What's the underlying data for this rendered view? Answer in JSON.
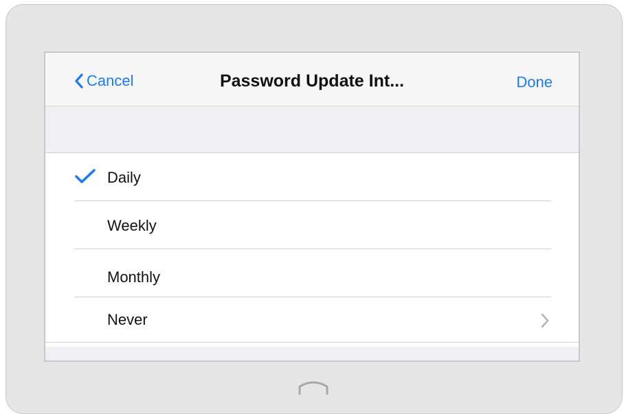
{
  "navbar": {
    "back_label": "Cancel",
    "title": "Password Update Int...",
    "done_label": "Done"
  },
  "options": [
    {
      "label": "Daily",
      "selected": true
    },
    {
      "label": "Weekly",
      "selected": false
    },
    {
      "label": "Monthly",
      "selected": false
    },
    {
      "label": "Never",
      "selected": false,
      "has_disclosure": true
    }
  ],
  "colors": {
    "accent": "#1a7cf0",
    "group_background": "#efeff4",
    "device_bezel": "#e6e6e6"
  },
  "icons": {
    "back": "chevron-left-icon",
    "selected": "checkmark-icon",
    "disclosure": "chevron-right-icon",
    "home": "home-button-icon"
  }
}
